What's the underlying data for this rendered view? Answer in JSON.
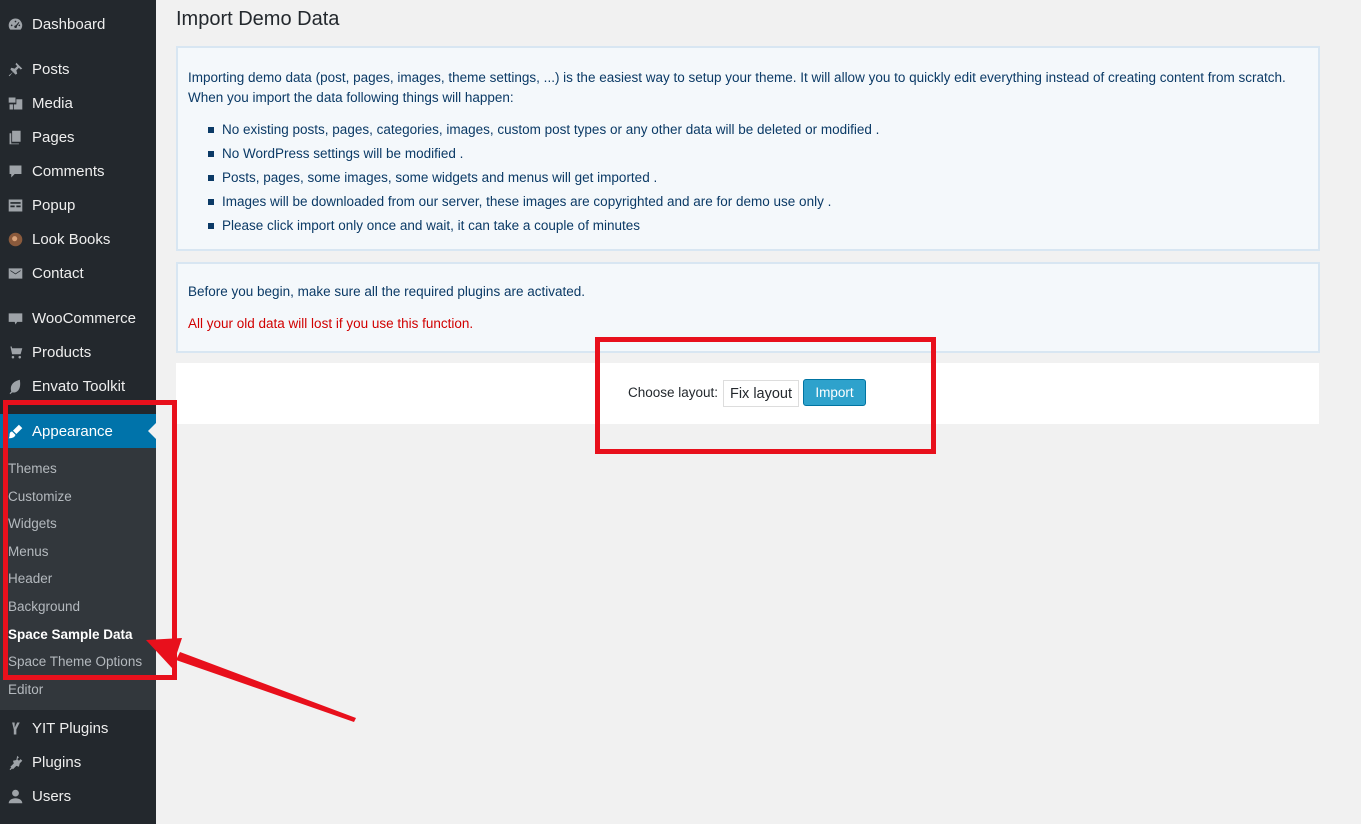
{
  "sidebar": {
    "items": [
      {
        "label": "Dashboard",
        "icon": "dashboard-icon"
      },
      {
        "label": "Posts",
        "icon": "pin-icon"
      },
      {
        "label": "Media",
        "icon": "media-icon"
      },
      {
        "label": "Pages",
        "icon": "pages-icon"
      },
      {
        "label": "Comments",
        "icon": "comments-icon"
      },
      {
        "label": "Popup",
        "icon": "popup-icon"
      },
      {
        "label": "Look Books",
        "icon": "lookbooks-icon"
      },
      {
        "label": "Contact",
        "icon": "mail-icon"
      },
      {
        "label": "WooCommerce",
        "icon": "woocommerce-icon"
      },
      {
        "label": "Products",
        "icon": "cart-icon"
      },
      {
        "label": "Envato Toolkit",
        "icon": "leaf-icon"
      },
      {
        "label": "Appearance",
        "icon": "brush-icon"
      },
      {
        "label": "YIT Plugins",
        "icon": "yit-icon"
      },
      {
        "label": "Plugins",
        "icon": "plug-icon"
      },
      {
        "label": "Users",
        "icon": "user-icon"
      }
    ],
    "submenu": [
      "Themes",
      "Customize",
      "Widgets",
      "Menus",
      "Header",
      "Background",
      "Space Sample Data",
      "Space Theme Options",
      "Editor"
    ]
  },
  "main": {
    "title": "Import Demo Data",
    "intro": "Importing demo data (post, pages, images, theme settings, ...) is the easiest way to setup your theme. It will allow you to quickly edit everything instead of creating content from scratch. When you import the data following things will happen:",
    "bullets": [
      "No existing posts, pages, categories, images, custom post types or any other data will be deleted or modified .",
      "No WordPress settings will be modified .",
      "Posts, pages, some images, some widgets and menus will get imported .",
      "Images will be downloaded from our server, these images are copyrighted and are for demo use only .",
      "Please click import only once and wait, it can take a couple of minutes"
    ],
    "notice": "Before you begin, make sure all the required plugins are activated.",
    "warning": "All your old data will lost if you use this function.",
    "choose_label": "Choose layout:",
    "layout_value": "Fix layout",
    "import_label": "Import"
  },
  "colors": {
    "sidebar_bg": "#23282d",
    "active_bg": "#0073aa",
    "annotation": "#e8101c",
    "warning": "#d10000",
    "button": "#2ea2cc"
  }
}
